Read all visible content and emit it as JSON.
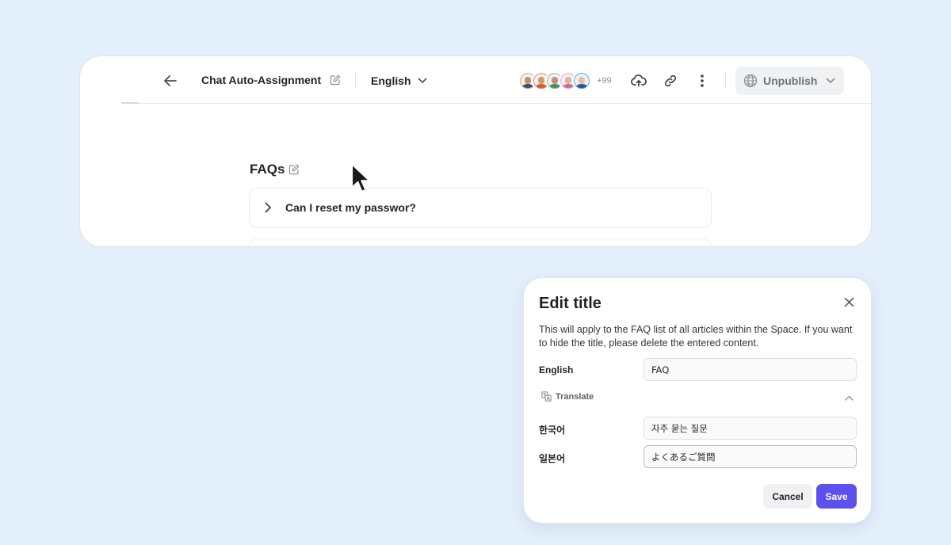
{
  "colors": {
    "background": "#e3effb",
    "accent": "#5c50ee",
    "muted_button": "#eff1f3"
  },
  "header": {
    "back_icon": "arrow-left-icon",
    "document_title": "Chat Auto-Assignment",
    "language": "English",
    "avatars": [
      {
        "ring": "#c9a37b",
        "face": "#c98d62",
        "body": "#3b4b6b"
      },
      {
        "ring": "#e58450",
        "face": "#d99766",
        "body": "#d85c3a"
      },
      {
        "ring": "#8fbf73",
        "face": "#c8906a",
        "body": "#4a8a6a"
      },
      {
        "ring": "#e7a8c4",
        "face": "#e2b48f",
        "body": "#c96b9a"
      },
      {
        "ring": "#4aa3e8",
        "face": "#e6c0a0",
        "body": "#27588f"
      }
    ],
    "avatar_overflow": "+99",
    "upload_icon": "cloud-upload-icon",
    "link_icon": "link-icon",
    "more_icon": "more-vertical-icon",
    "unpublish_label": "Unpublish"
  },
  "content": {
    "faq_heading": "FAQs",
    "faq_items": [
      {
        "question": "Can I reset my passwor?"
      }
    ]
  },
  "dialog": {
    "title": "Edit title",
    "description": "This will apply to the FAQ list of all articles within the Space. If you want to hide the title, please delete the entered content.",
    "fields": {
      "english_label": "English",
      "english_value": "FAQ",
      "translate_label": "Translate",
      "korean_label": "한국어",
      "korean_value": "자주 묻는 질문",
      "japanese_label": "일본어",
      "japanese_value": "よくあるご質問"
    },
    "cancel_label": "Cancel",
    "save_label": "Save"
  }
}
